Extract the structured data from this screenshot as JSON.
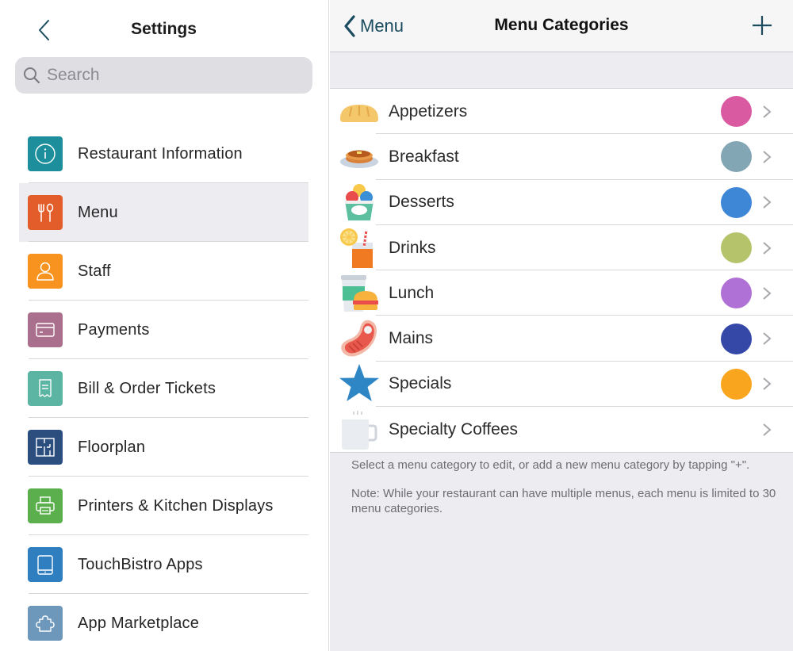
{
  "left": {
    "title": "Settings",
    "back_icon": "chevron-left-icon",
    "search": {
      "placeholder": "Search",
      "value": ""
    },
    "items": [
      {
        "label": "Restaurant Information",
        "icon": "info-icon",
        "color": "#1d8e9c",
        "selected": false
      },
      {
        "label": "Menu",
        "icon": "fork-spoon-icon",
        "color": "#e35d2b",
        "selected": true
      },
      {
        "label": "Staff",
        "icon": "person-icon",
        "color": "#f7931e",
        "selected": false
      },
      {
        "label": "Payments",
        "icon": "credit-card-icon",
        "color": "#a96f8c",
        "selected": false
      },
      {
        "label": "Bill & Order Tickets",
        "icon": "receipt-icon",
        "color": "#5cb5a2",
        "selected": false
      },
      {
        "label": "Floorplan",
        "icon": "floorplan-icon",
        "color": "#2b4e7f",
        "selected": false
      },
      {
        "label": "Printers & Kitchen Displays",
        "icon": "printer-icon",
        "color": "#5bb04d",
        "selected": false
      },
      {
        "label": "TouchBistro Apps",
        "icon": "tablet-icon",
        "color": "#2f7fc0",
        "selected": false
      },
      {
        "label": "App Marketplace",
        "icon": "puzzle-icon",
        "color": "#6d97bb",
        "selected": false
      }
    ]
  },
  "right": {
    "back_label": "Menu",
    "title": "Menu Categories",
    "add_icon": "plus-icon",
    "categories": [
      {
        "label": "Appetizers",
        "icon": "bread-icon",
        "color": "#d95aa0"
      },
      {
        "label": "Breakfast",
        "icon": "pancakes-icon",
        "color": "#82a6b3"
      },
      {
        "label": "Desserts",
        "icon": "ice-cream-icon",
        "color": "#3e86d6"
      },
      {
        "label": "Drinks",
        "icon": "drink-icon",
        "color": "#b5c46b"
      },
      {
        "label": "Lunch",
        "icon": "burger-icon",
        "color": "#b071d6"
      },
      {
        "label": "Mains",
        "icon": "steak-icon",
        "color": "#3548a8"
      },
      {
        "label": "Specials",
        "icon": "star-icon",
        "color": "#f9a51d"
      },
      {
        "label": "Specialty Coffees",
        "icon": "coffee-mug-icon",
        "color": null
      }
    ],
    "footer": {
      "hint": "Select a menu category to edit, or add a new menu category by tapping \"+\".",
      "note": "Note: While your restaurant can have multiple menus, each menu is limited to 30 menu categories."
    }
  }
}
